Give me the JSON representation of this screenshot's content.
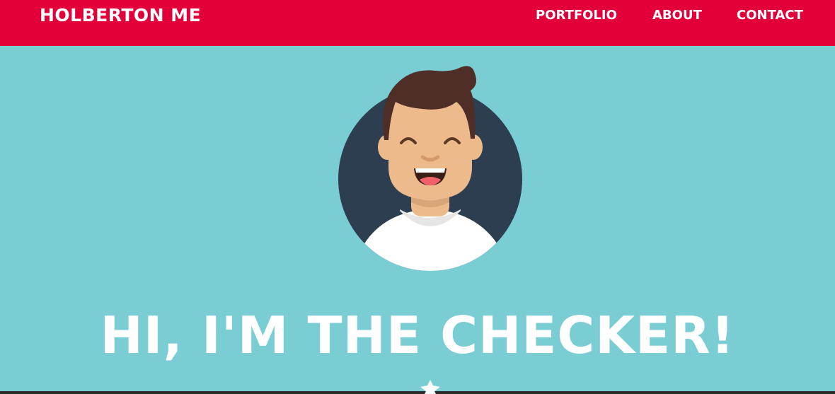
{
  "header": {
    "brand": "HOLBERTON ME",
    "nav": [
      {
        "label": "PORTFOLIO"
      },
      {
        "label": "ABOUT"
      },
      {
        "label": "CONTACT"
      }
    ]
  },
  "hero": {
    "title": "HI, I'M THE CHECKER!",
    "avatar_icon": "avatar-icon"
  },
  "colors": {
    "navbar": "#E3003A",
    "background": "#7ACDD3",
    "avatar_circle": "#2C3E50",
    "skin": "#EDBA8C",
    "hair": "#4F2E28",
    "shirt": "#FFFFFF",
    "text": "#FFFFFF"
  }
}
